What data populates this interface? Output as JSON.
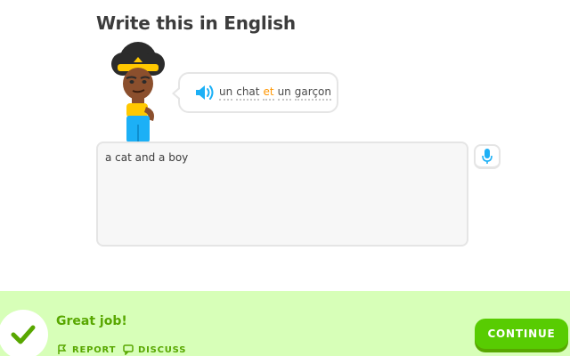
{
  "header": {
    "title": "Write this in English"
  },
  "prompt": {
    "speaker_icon": "speaker-icon",
    "words": [
      {
        "text": "un",
        "highlight": false
      },
      {
        "text": "chat",
        "highlight": false
      },
      {
        "text": "et",
        "highlight": true
      },
      {
        "text": "un",
        "highlight": false
      },
      {
        "text": "garçon",
        "highlight": false
      }
    ]
  },
  "answer": {
    "value": "a cat and a boy"
  },
  "mic": {
    "icon": "microphone-icon"
  },
  "feedback": {
    "message": "Great job!",
    "report_label": "REPORT",
    "discuss_label": "DISCUSS",
    "continue_label": "CONTINUE",
    "status_icon": "checkmark-icon"
  },
  "colors": {
    "accent_green": "#58cc02",
    "dark_green": "#58a700",
    "footer_bg": "#d7ffb8",
    "speaker_blue": "#1cb0f6",
    "highlight_orange": "#ff9600"
  }
}
